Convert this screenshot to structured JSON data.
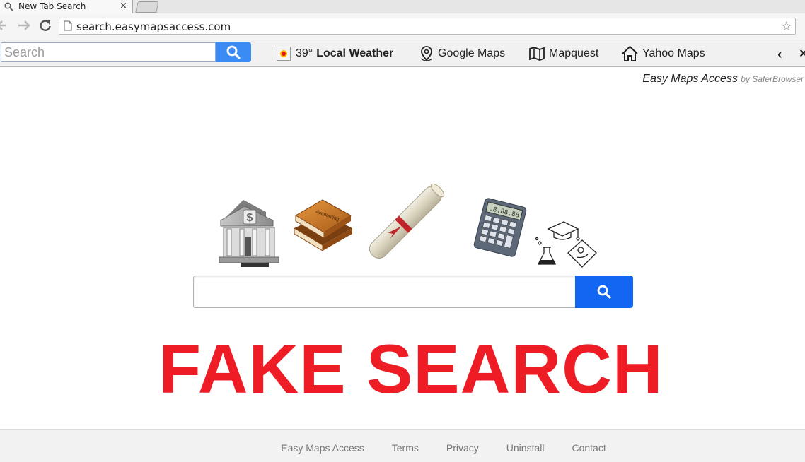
{
  "browser": {
    "tab_title": "New Tab Search",
    "tab_close": "×",
    "url": "search.easymapsaccess.com",
    "star": "☆"
  },
  "toolbar": {
    "search_placeholder": "Search",
    "weather_temp": "39°",
    "weather_label": "Local Weather",
    "links": [
      {
        "label": "Google Maps",
        "icon": "map-pin-icon"
      },
      {
        "label": "Mapquest",
        "icon": "folded-map-icon"
      },
      {
        "label": "Yahoo Maps",
        "icon": "house-icon"
      }
    ],
    "scroll_left": "‹",
    "scroll_close": "×"
  },
  "brand": {
    "name": "Easy Maps Access",
    "by": "by SaferBrowser"
  },
  "icons": [
    "bank-icon",
    "accounting-book-icon",
    "diploma-scroll-icon",
    "calculator-icon",
    "science-doodle-icon"
  ],
  "book_label": "Accounting",
  "overlay_text": "FAKE SEARCH",
  "footer": {
    "links": [
      "Easy Maps Access",
      "Terms",
      "Privacy",
      "Uninstall",
      "Contact"
    ]
  }
}
